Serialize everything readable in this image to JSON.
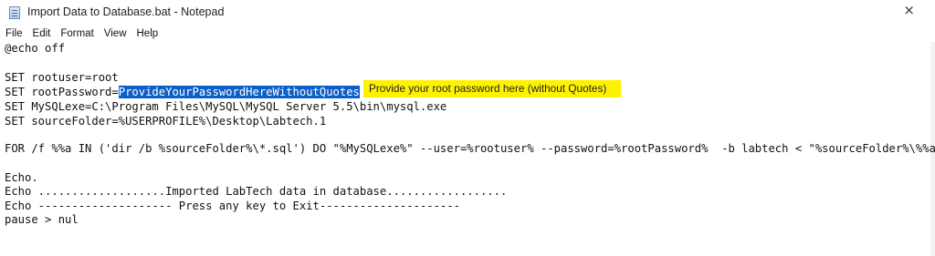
{
  "window": {
    "title": "Import Data to Database.bat - Notepad",
    "app_icon": "notepad-icon",
    "close_glyph": "×"
  },
  "menu": [
    "File",
    "Edit",
    "Format",
    "View",
    "Help"
  ],
  "editor": {
    "lines": [
      "@echo off",
      "",
      "SET rootuser=root",
      "SET rootPassword=",
      "SET MySQLexe=C:\\Program Files\\MySQL\\MySQL Server 5.5\\bin\\mysql.exe",
      "SET sourceFolder=%USERPROFILE%\\Desktop\\Labtech.1",
      "",
      "FOR /f %%a IN ('dir /b %sourceFolder%\\*.sql') DO \"%MySQLexe%\" --user=%rootuser% --password=%rootPassword%  -b labtech < \"%sourceFolder%\\%%a\"",
      "",
      "Echo.",
      "Echo ...................Imported LabTech data in database..................",
      "Echo -------------------- Press any key to Exit---------------------",
      "pause > nul"
    ],
    "selected_text": "ProvideYourPasswordHereWithoutQuotes",
    "selection_color": "#0a5fc8"
  },
  "annotation": {
    "text": "Provide your root password here (without Quotes)",
    "color": "#fff200"
  }
}
